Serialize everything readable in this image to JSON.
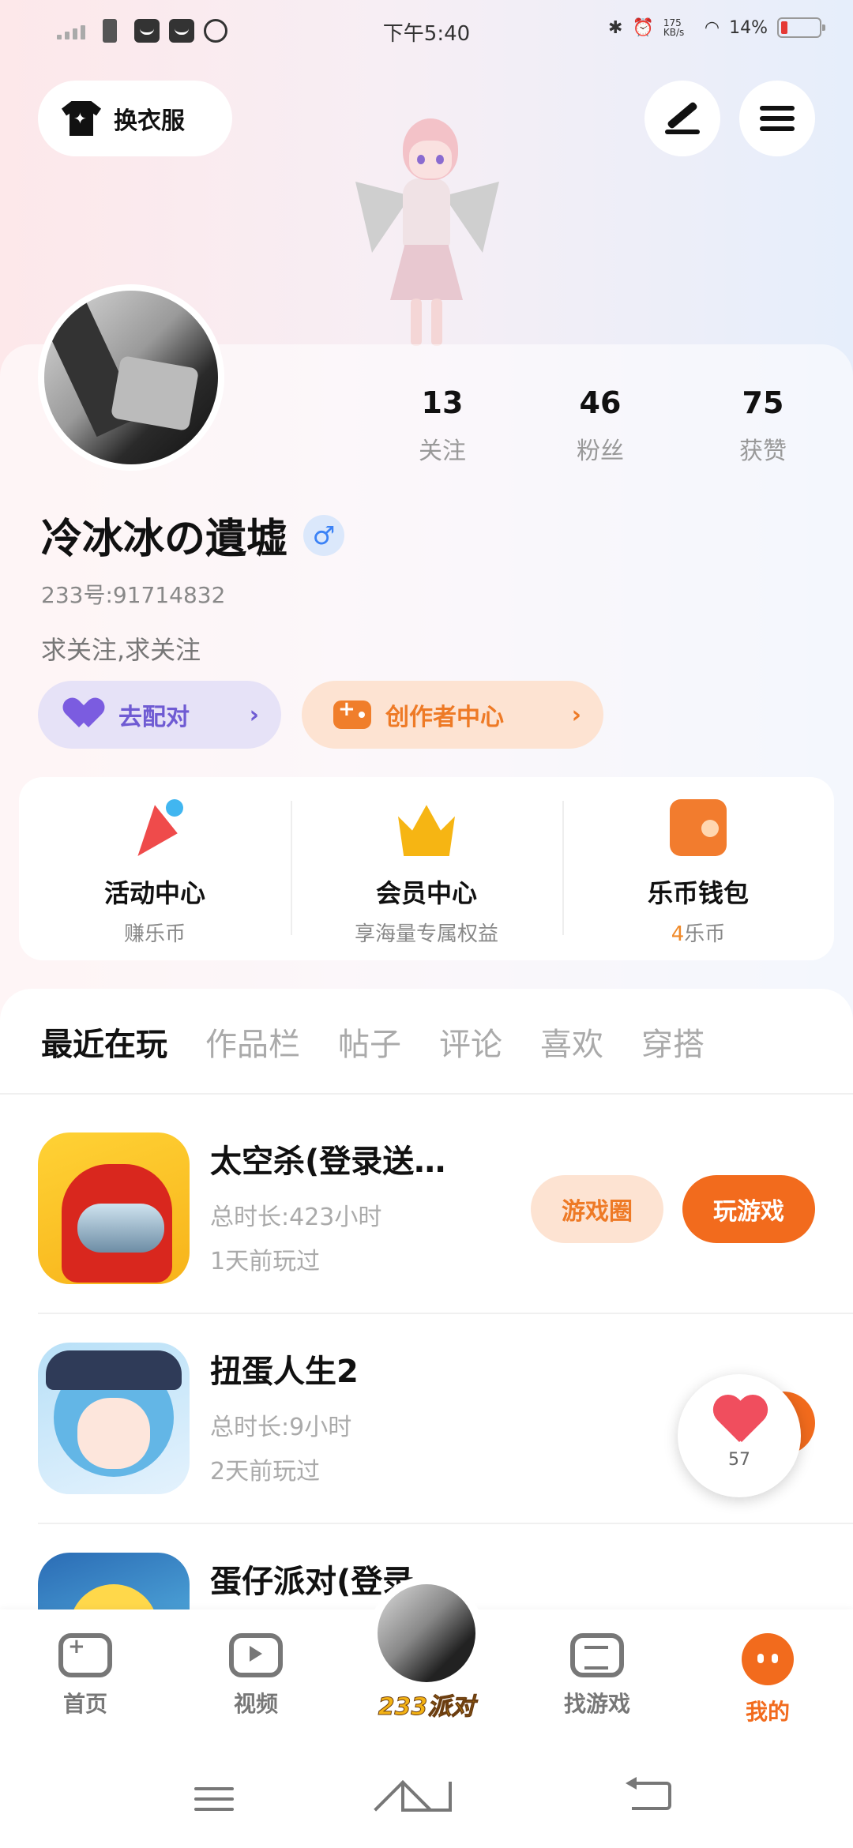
{
  "status_bar": {
    "time": "下午5:40",
    "net_speed": "175 KB/s",
    "battery": "14%"
  },
  "toolbar": {
    "outfit_label": "换衣服"
  },
  "profile": {
    "stats": [
      {
        "value": "13",
        "label": "关注"
      },
      {
        "value": "46",
        "label": "粉丝"
      },
      {
        "value": "75",
        "label": "获赞"
      }
    ],
    "name": "冷冰冰の遺墟",
    "gender": "♂",
    "uid": "233号:91714832",
    "bio": "求关注,求关注",
    "match_label": "去配对",
    "creator_label": "创作者中心"
  },
  "features": [
    {
      "title": "活动中心",
      "sub": "赚乐币",
      "icon": "party-popper-icon"
    },
    {
      "title": "会员中心",
      "sub": "享海量专属权益",
      "icon": "crown-icon"
    },
    {
      "title": "乐币钱包",
      "sub_num": "4",
      "sub": "乐币",
      "icon": "wallet-icon"
    }
  ],
  "tabs": [
    "最近在玩",
    "作品栏",
    "帖子",
    "评论",
    "喜欢",
    "穿搭"
  ],
  "games": [
    {
      "name": "太空杀(登录送…",
      "duration": "总时长:423小时",
      "last": "1天前玩过",
      "circle_label": "游戏圈",
      "play_label": "玩游戏"
    },
    {
      "name": "扭蛋人生2",
      "duration": "总时长:9小时",
      "last": "2天前玩过"
    },
    {
      "name": "蛋仔派对(登录…"
    }
  ],
  "like_count": "57",
  "nav": {
    "home": "首页",
    "video": "视频",
    "party": "233派对",
    "find": "找游戏",
    "me": "我的"
  },
  "colors": {
    "accent": "#f26b1d",
    "match": "#6f5bd3",
    "gold": "#f6b513"
  }
}
